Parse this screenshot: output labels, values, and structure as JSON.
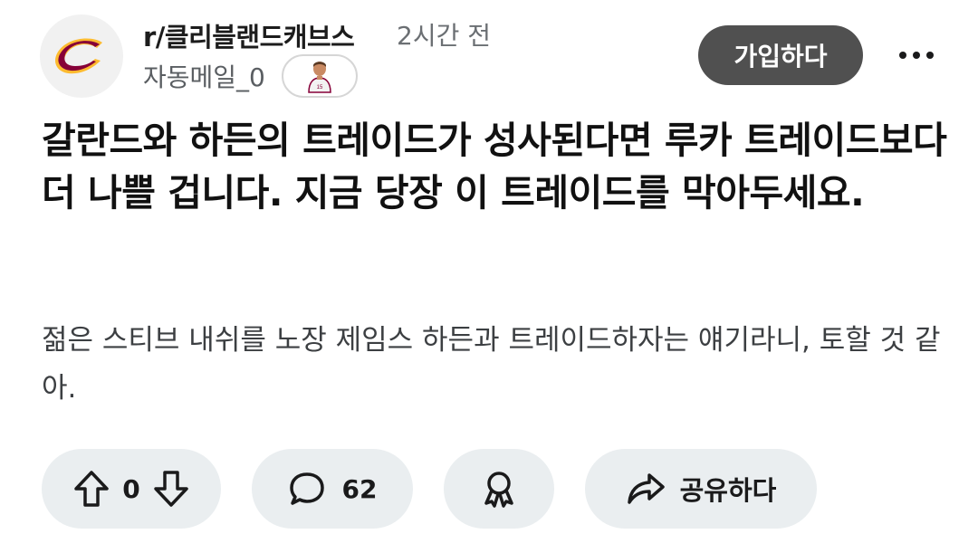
{
  "header": {
    "community": "r/클리블랜드캐브스",
    "time_ago": "2시간 전",
    "author": "자동메일_0",
    "join_label": "가입하다",
    "more_icon": "more-horizontal-icon"
  },
  "post": {
    "title": "갈란드와 하든의 트레이드가 성사된다면 루카 트레이드보다 더 나쁠 겁니다. 지금 당장 이 트레이드를 막아두세요.",
    "body": "젊은 스티브 내쉬를 노장 제임스 하든과 트레이드하자는 얘기라니, 토할 것 같아."
  },
  "actions": {
    "vote_count": "0",
    "comment_count": "62",
    "share_label": "공유하다"
  },
  "colors": {
    "logo_wine": "#860038",
    "logo_gold": "#FDBB30",
    "join_bg": "#505050",
    "pill_bg": "#eaeef0"
  }
}
